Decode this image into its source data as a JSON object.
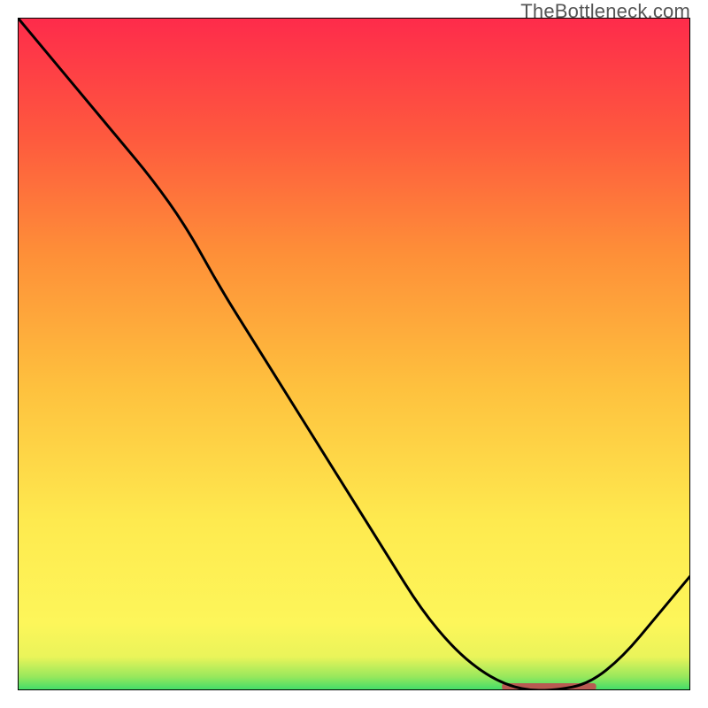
{
  "watermark": "TheBottleneck.com",
  "chart_data": {
    "type": "line",
    "title": "",
    "xlabel": "",
    "ylabel": "",
    "x_range": [
      0,
      100
    ],
    "y_range": [
      0,
      100
    ],
    "series": [
      {
        "name": "curve",
        "x": [
          0,
          5,
          10,
          15,
          20,
          25,
          30,
          35,
          40,
          45,
          50,
          55,
          60,
          65,
          70,
          75,
          80,
          85,
          90,
          95,
          100
        ],
        "y": [
          100,
          94,
          88,
          82,
          76,
          69,
          60,
          52,
          44,
          36,
          28,
          20,
          12,
          6,
          2,
          0,
          0,
          1,
          5,
          11,
          17
        ]
      }
    ],
    "optimal_band": {
      "x_start": 72,
      "x_end": 86
    },
    "gradient_stops": [
      {
        "offset": 0.0,
        "color": "#3ddc6a"
      },
      {
        "offset": 0.02,
        "color": "#97e85c"
      },
      {
        "offset": 0.05,
        "color": "#eaf45a"
      },
      {
        "offset": 0.1,
        "color": "#fdf65a"
      },
      {
        "offset": 0.25,
        "color": "#feea4f"
      },
      {
        "offset": 0.45,
        "color": "#fec13e"
      },
      {
        "offset": 0.65,
        "color": "#fe8f38"
      },
      {
        "offset": 0.82,
        "color": "#fe5a3e"
      },
      {
        "offset": 1.0,
        "color": "#fe2b4b"
      }
    ]
  }
}
